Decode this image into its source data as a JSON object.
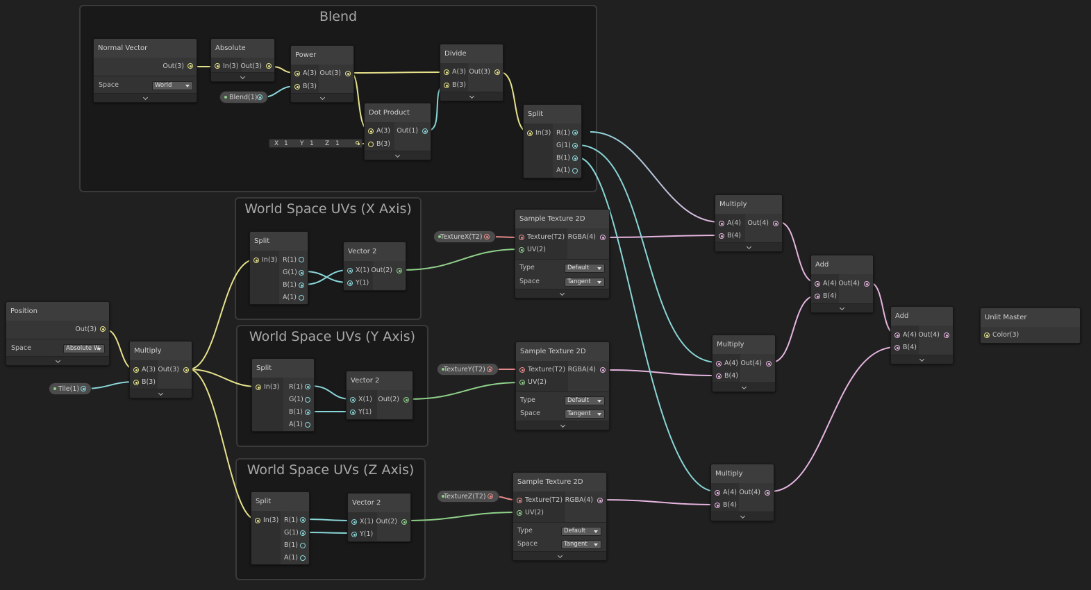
{
  "groups": {
    "blend": "Blend",
    "uv_x": "World Space UVs (X Axis)",
    "uv_y": "World Space UVs (Y Axis)",
    "uv_z": "World Space UVs (Z Axis)"
  },
  "nodes": {
    "normal_vector": {
      "title": "Normal Vector",
      "out": "Out(3)",
      "space_label": "Space",
      "space_value": "World"
    },
    "absolute": {
      "title": "Absolute",
      "in": "In(3)",
      "out": "Out(3)"
    },
    "power": {
      "title": "Power",
      "a": "A(3)",
      "b": "B(3)",
      "out": "Out(3)"
    },
    "divide": {
      "title": "Divide",
      "a": "A(3)",
      "b": "B(3)",
      "out": "Out(3)"
    },
    "dot_product": {
      "title": "Dot Product",
      "a": "A(3)",
      "b": "B(3)",
      "out": "Out(1)"
    },
    "split_blend": {
      "title": "Split",
      "in": "In(3)",
      "r": "R(1)",
      "g": "G(1)",
      "b": "B(1)",
      "a": "A(1)"
    },
    "split_x": {
      "title": "Split",
      "in": "In(3)",
      "r": "R(1)",
      "g": "G(1)",
      "b": "B(1)",
      "a": "A(1)"
    },
    "vector2_x": {
      "title": "Vector 2",
      "x": "X(1)",
      "y": "Y(1)",
      "out": "Out(2)"
    },
    "split_y": {
      "title": "Split",
      "in": "In(3)",
      "r": "R(1)",
      "g": "G(1)",
      "b": "B(1)",
      "a": "A(1)"
    },
    "vector2_y": {
      "title": "Vector 2",
      "x": "X(1)",
      "y": "Y(1)",
      "out": "Out(2)"
    },
    "split_z": {
      "title": "Split",
      "in": "In(3)",
      "r": "R(1)",
      "g": "G(1)",
      "b": "B(1)",
      "a": "A(1)"
    },
    "vector2_z": {
      "title": "Vector 2",
      "x": "X(1)",
      "y": "Y(1)",
      "out": "Out(2)"
    },
    "position": {
      "title": "Position",
      "out": "Out(3)",
      "space_label": "Space",
      "space_value": "Absolute W"
    },
    "multiply_tile": {
      "title": "Multiply",
      "a": "A(3)",
      "b": "B(3)",
      "out": "Out(3)"
    },
    "sample_x": {
      "title": "Sample Texture 2D",
      "texture": "Texture(T2)",
      "uv": "UV(2)",
      "rgba": "RGBA(4)",
      "type_label": "Type",
      "type_value": "Default",
      "space_label": "Space",
      "space_value": "Tangent"
    },
    "sample_y": {
      "title": "Sample Texture 2D",
      "texture": "Texture(T2)",
      "uv": "UV(2)",
      "rgba": "RGBA(4)",
      "type_label": "Type",
      "type_value": "Default",
      "space_label": "Space",
      "space_value": "Tangent"
    },
    "sample_z": {
      "title": "Sample Texture 2D",
      "texture": "Texture(T2)",
      "uv": "UV(2)",
      "rgba": "RGBA(4)",
      "type_label": "Type",
      "type_value": "Default",
      "space_label": "Space",
      "space_value": "Tangent"
    },
    "multiply_1": {
      "title": "Multiply",
      "a": "A(4)",
      "b": "B(4)",
      "out": "Out(4)"
    },
    "multiply_2": {
      "title": "Multiply",
      "a": "A(4)",
      "b": "B(4)",
      "out": "Out(4)"
    },
    "multiply_3": {
      "title": "Multiply",
      "a": "A(4)",
      "b": "B(4)",
      "out": "Out(4)"
    },
    "add_1": {
      "title": "Add",
      "a": "A(4)",
      "b": "B(4)",
      "out": "Out(4)"
    },
    "add_2": {
      "title": "Add",
      "a": "A(4)",
      "b": "B(4)",
      "out": "Out(4)"
    },
    "unlit_master": {
      "title": "Unlit Master",
      "color": "Color(3)"
    }
  },
  "properties": {
    "blend": "Blend(1)",
    "tile": "Tile(1)",
    "texture_x": "TextureX(T2)",
    "texture_y": "TextureY(T2)",
    "texture_z": "TextureZ(T2)"
  },
  "vector_input": {
    "x_label": "X",
    "x_value": "1",
    "y_label": "Y",
    "y_value": "1",
    "z_label": "Z",
    "z_value": "1"
  },
  "colors": {
    "vector3": "#e6e28b",
    "vector1": "#8ad6d8",
    "vector2": "#8fd08a",
    "vector4": "#e6b5e0",
    "texture": "#e58a8a"
  }
}
